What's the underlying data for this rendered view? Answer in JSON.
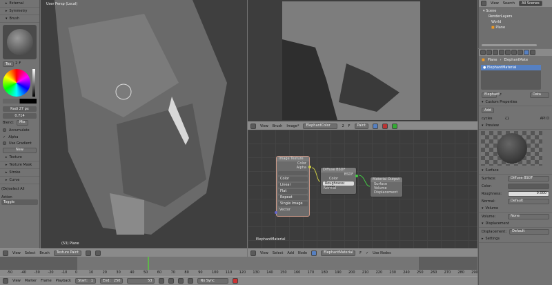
{
  "tool_panel": {
    "sections_top": [
      "External",
      "Symmetry",
      "Brush"
    ],
    "tex_label": "Tex",
    "tex_num": "2",
    "tex_f": "F",
    "radius": "Radi 27 px",
    "strength": "0.714",
    "blend_label": "Blend:",
    "blend_value": "Mix",
    "accumulate": "Accumulate",
    "alpha": "Alpha",
    "use_gradient": "Use Gradient",
    "new_label": "New",
    "sections_bottom": [
      "Texture",
      "Texture Mask",
      "Stroke",
      "Curve"
    ],
    "operator": "(De)select All",
    "action_label": "Action",
    "action_value": "Toggle"
  },
  "viewport": {
    "label": "User Persp (Local)",
    "object": "(53) Plane",
    "menus": [
      "View",
      "Select",
      "Brush"
    ],
    "mode": "Texture Paint"
  },
  "image_editor": {
    "menus": [
      "View",
      "Brush",
      "Image*"
    ],
    "image_name": "ElephantColor",
    "users": "2",
    "f": "F",
    "mode": "Paint"
  },
  "node_editor": {
    "menus": [
      "View",
      "Select",
      "Add",
      "Node"
    ],
    "material": "ElephantMaterial",
    "f": "F",
    "use_nodes": "Use Nodes",
    "footer_label": "ElephantMaterial",
    "image_texture": {
      "title": "Image Texture",
      "out_color": "Color",
      "out_alpha": "Alpha",
      "options": [
        "Color",
        "Linear",
        "Flat",
        "Repeat",
        "Single Image"
      ],
      "in_vector": "Vector"
    },
    "diffuse": {
      "title": "Diffuse BSDF",
      "out": "BSDF",
      "color": "Color",
      "roughness": "Roughness: 0.000",
      "normal": "Normal"
    },
    "output": {
      "title": "Material Output",
      "inputs": [
        "Surface",
        "Volume",
        "Displacement"
      ]
    }
  },
  "timeline": {
    "menus": [
      "View",
      "Marker",
      "Frame",
      "Playback"
    ],
    "start": "Start:",
    "start_val": "1",
    "end": "End:",
    "end_val": "250",
    "current": "53",
    "sync": "No Sync",
    "ruler": [
      "-50",
      "-40",
      "-30",
      "-20",
      "-10",
      "0",
      "10",
      "20",
      "30",
      "40",
      "50",
      "60",
      "70",
      "80",
      "90",
      "100",
      "110",
      "120",
      "130",
      "140",
      "150",
      "160",
      "170",
      "180",
      "190",
      "200",
      "210",
      "220",
      "230",
      "240",
      "250",
      "260",
      "270",
      "280",
      "290"
    ],
    "current_frame": 53
  },
  "outliner": {
    "menus": [
      "View",
      "Search"
    ],
    "scope": "All Scenes",
    "items": [
      "Scene",
      "RenderLayers",
      "World",
      "Plane"
    ]
  },
  "properties": {
    "breadcrumb": [
      "Plane",
      "ElephantMate"
    ],
    "slot": "ElephantMaterial",
    "mat_name": "Elephant",
    "mat_f": "F",
    "data": "Data",
    "custom_props": "Custom Properties",
    "add": "Add",
    "prop_name": "cycles",
    "prop_val": "{}",
    "api": "API D",
    "preview": "Preview",
    "surface": "Surface",
    "surface_label": "Surface:",
    "surface_val": "Diffuse BSDF",
    "color_label": "Color:",
    "roughness_label": "Roughness:",
    "roughness_val": "0.000",
    "normal_label": "Normal:",
    "normal_val": "Default",
    "volume": "Volume",
    "volume_label": "Volume:",
    "volume_val": "None",
    "displacement": "Displacement",
    "disp_label": "Displacement:",
    "disp_val": "Default",
    "settings": "Settings"
  },
  "colors": {
    "accent": "#5680c2",
    "timeline_cursor": "#5fb84a"
  }
}
